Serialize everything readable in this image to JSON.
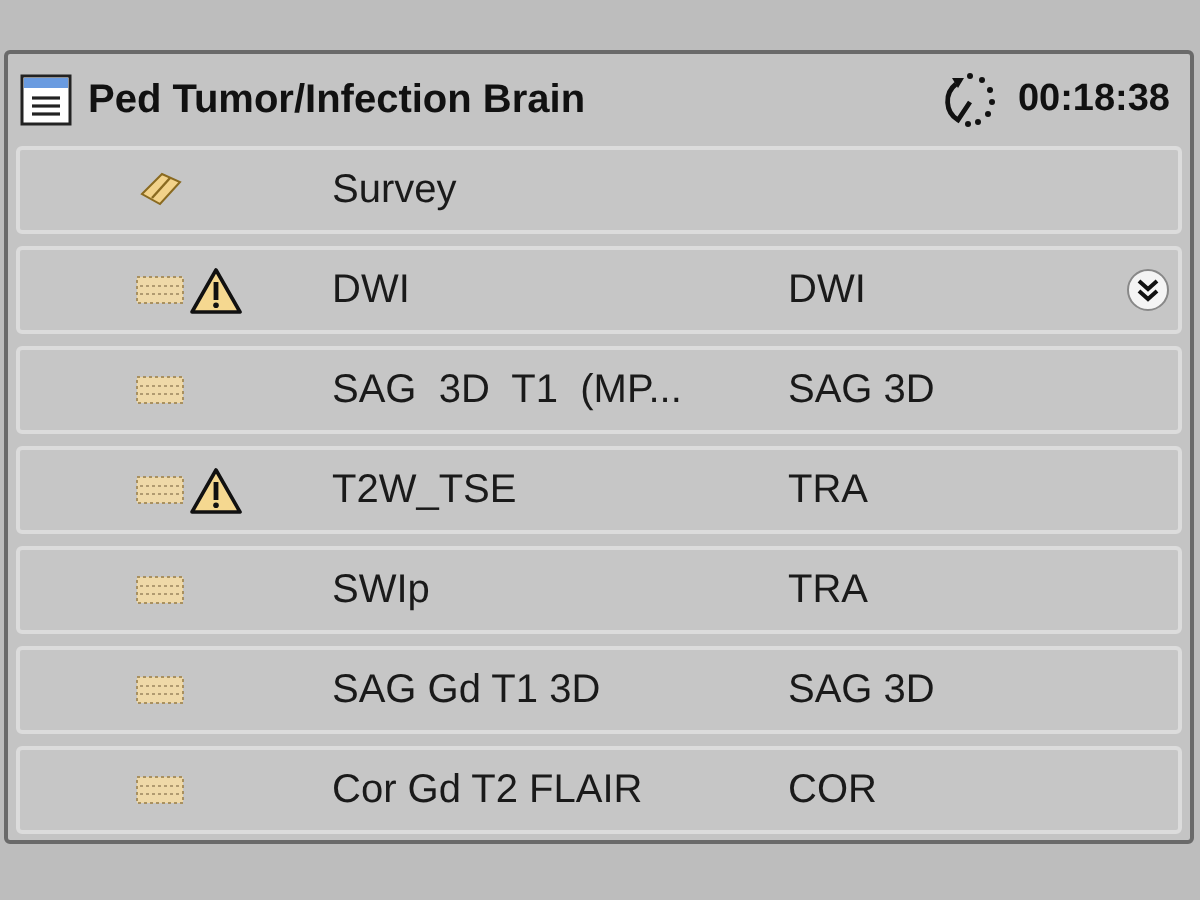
{
  "header": {
    "title": "Ped Tumor/Infection Brain",
    "duration": "00:18:38"
  },
  "rows": [
    {
      "kind": "survey",
      "warning": false,
      "name": "Survey",
      "expandable": false
    },
    {
      "kind": "scan",
      "warning": true,
      "name": "DWI",
      "orientation": "DWI",
      "expandable": true
    },
    {
      "kind": "scan",
      "warning": false,
      "name": "SAG  3D  T1  (MP...",
      "orientation": "SAG 3D",
      "expandable": false
    },
    {
      "kind": "scan",
      "warning": true,
      "name": "T2W_TSE",
      "orientation": "TRA",
      "expandable": false
    },
    {
      "kind": "scan",
      "warning": false,
      "name": "SWIp",
      "orientation": "TRA",
      "expandable": false
    },
    {
      "kind": "scan",
      "warning": false,
      "name": "SAG Gd T1 3D",
      "orientation": "SAG 3D",
      "expandable": false
    },
    {
      "kind": "scan",
      "warning": false,
      "name": "Cor Gd T2 FLAIR",
      "orientation": "COR",
      "expandable": false
    }
  ]
}
